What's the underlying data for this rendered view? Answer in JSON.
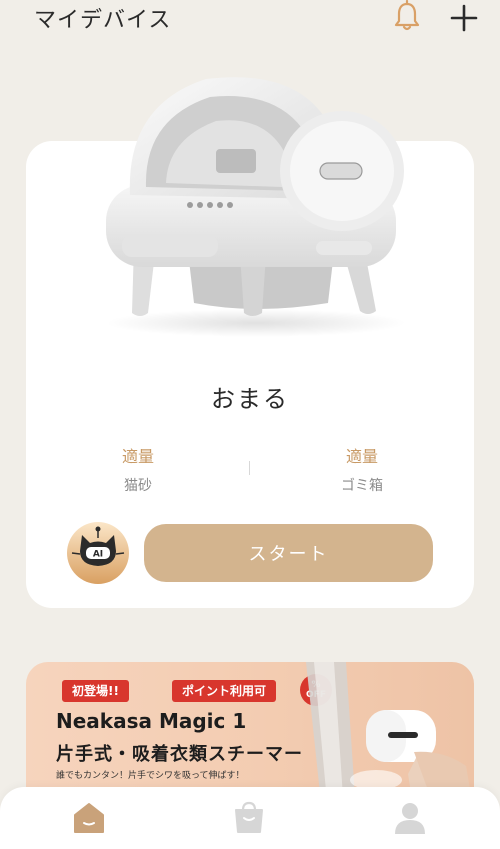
{
  "header": {
    "title": "マイデバイス",
    "icons": {
      "bell": "bell-icon",
      "add": "plus-icon"
    }
  },
  "device": {
    "name": "おまる",
    "image": "litter-box-device-image",
    "status": [
      {
        "value": "適量",
        "label": "猫砂"
      },
      {
        "value": "適量",
        "label": "ゴミ箱"
      }
    ],
    "ai_avatar_text": "AI",
    "start_label": "スタート"
  },
  "banner": {
    "tags": [
      "初登場!!",
      "ポイント利用可"
    ],
    "off_badge": {
      "top": "%",
      "bottom": "OFF"
    },
    "title": "Neakasa Magic 1",
    "subtitle": "片手式・吸着衣類スチーマー",
    "caption": "誰でもカンタン！片手でシワを吸って伸ばす！"
  },
  "bottom_nav": {
    "items": [
      {
        "name": "home",
        "icon": "home-icon",
        "active": true
      },
      {
        "name": "shop",
        "icon": "shopping-bag-icon",
        "active": false
      },
      {
        "name": "profile",
        "icon": "user-icon",
        "active": false
      }
    ]
  },
  "colors": {
    "background": "#f1eee8",
    "accent": "#d3b48e",
    "status_value": "#c89a66",
    "nav_active": "#c9a27a",
    "nav_inactive": "#d6d6d6",
    "promo_red": "#d8362d"
  }
}
